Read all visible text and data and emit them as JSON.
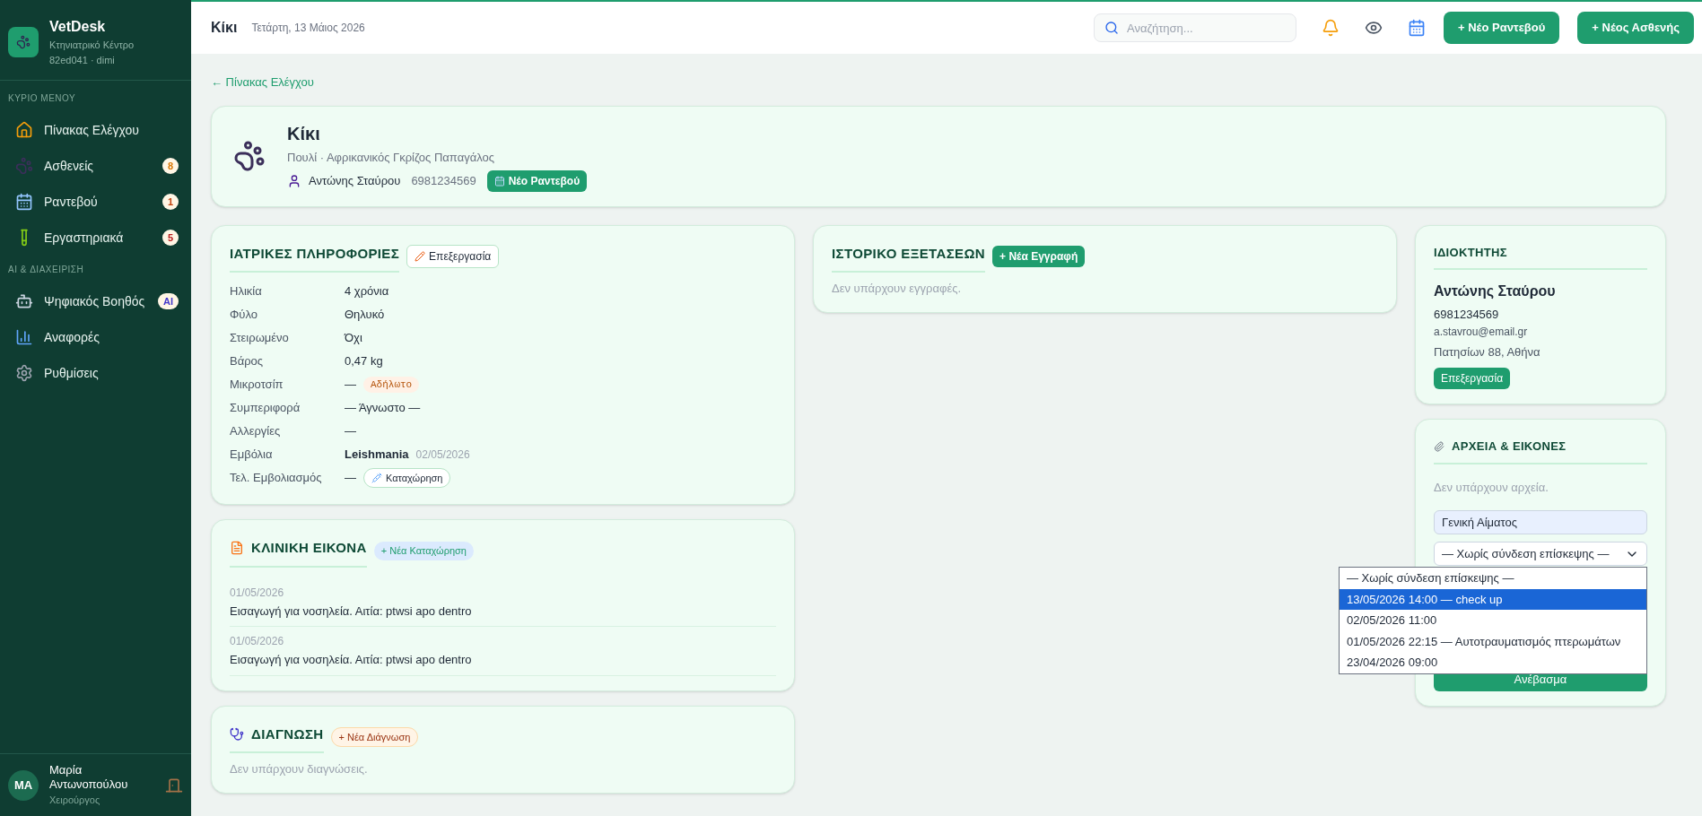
{
  "sidebar": {
    "app_name": "VetDesk",
    "subtitle": "Κτηνιατρικό Κέντρο",
    "build": "82ed041 · dimi",
    "sections": [
      {
        "title": "ΚΥΡΙΟ ΜΕΝΟΥ",
        "items": [
          {
            "label": "Πίνακας Ελέγχου"
          },
          {
            "label": "Ασθενείς",
            "badge": "8",
            "color": "#d97706"
          },
          {
            "label": "Ραντεβού",
            "badge": "1",
            "color": "#c2410c"
          },
          {
            "label": "Εργαστηριακά",
            "badge": "5",
            "color": "#b91c1c"
          }
        ]
      },
      {
        "title": "AI & ΔΙΑΧΕΙΡΙΣΗ",
        "items": [
          {
            "label": "Ψηφιακός Βοηθός",
            "badge": "AI",
            "color": "#4338ca"
          },
          {
            "label": "Αναφορές"
          },
          {
            "label": "Ρυθμίσεις"
          }
        ]
      }
    ],
    "user": {
      "initials": "MA",
      "name": "Μαρία Αντωνοπούλου",
      "role": "Χειρούργος"
    }
  },
  "header": {
    "title": "Κίκι",
    "date": "Τετάρτη, 13 Μάιος 2026",
    "search": {
      "placeholder": "Αναζήτηση..."
    },
    "buttons": [
      "+ Νέο Ραντεβού",
      "+ Νέος Ασθενής"
    ]
  },
  "back_link": "← Πίνακας Ελέγχου",
  "patient": {
    "name": "Κίκι",
    "species": "Πουλί · Αφρικανικός Γκρίζος Παπαγάλος",
    "owner": "Αντώνης Σταύρου",
    "phone": "6981234569",
    "button": "Νέο Ραντεβού"
  },
  "medical_info": {
    "title": "ΙΑΤΡΙΚΕΣ ΠΛΗΡΟΦΟΡΙΕΣ",
    "edit_button": "Επεξεργασία",
    "rows": [
      {
        "label": "Ηλικία",
        "value": "4 χρόνια"
      },
      {
        "label": "Φύλο",
        "value": "Θηλυκό"
      },
      {
        "label": "Στειρωμένο",
        "value": "Όχι"
      },
      {
        "label": "Βάρος",
        "value": "0,47 kg"
      },
      {
        "label": "Μικροτσίπ",
        "value": "—",
        "tag": "Αδήλωτο"
      },
      {
        "label": "Συμπεριφορά",
        "value": "— Άγνωστο —"
      },
      {
        "label": "Αλλεργίες",
        "value": "—"
      },
      {
        "label": "Εμβόλια",
        "value": "Leishmania",
        "note": "02/05/2026"
      },
      {
        "label": "Τελ. Εμβολιασμός",
        "value": "—",
        "action": "Καταχώρηση"
      }
    ]
  },
  "clinical_picture": {
    "title": "ΚΛΙΝΙΚΗ ΕΙΚΟΝΑ",
    "add_button": "+ Νέα Καταχώρηση",
    "entries": [
      {
        "date": "01/05/2026",
        "text": "Εισαγωγή για νοσηλεία. Αιτία: ptwsi apo dentro"
      },
      {
        "date": "01/05/2026",
        "text": "Εισαγωγή για νοσηλεία. Αιτία: ptwsi apo dentro"
      }
    ]
  },
  "diagnosis": {
    "title": "ΔΙΑΓΝΩΣΗ",
    "add_button": "+ Νέα Διάγνωση",
    "empty": "Δεν υπάρχουν διαγνώσεις."
  },
  "exam_history": {
    "title": "ΙΣΤΟΡΙΚΟ ΕΞΕΤΑΣΕΩΝ",
    "add_button": "+ Νέα Εγγραφή",
    "empty": "Δεν υπάρχουν εγγραφές."
  },
  "owner": {
    "title": "ΙΔΙΟΚΤΗΤΗΣ",
    "name": "Αντώνης Σταύρου",
    "phone": "6981234569",
    "email": "a.stavrou@email.gr",
    "address": "Πατησίων 88, Αθήνα",
    "edit_button": "Επεξεργασία"
  },
  "files": {
    "title": "ΑΡΧΕΙΑ & ΕΙΚΟΝΕΣ",
    "empty": "Δεν υπάρχουν αρχεία.",
    "name_field": "Γενική Αίματος",
    "visit_select": "— Χωρίς σύνδεση επίσκεψης —",
    "options": [
      {
        "label": "— Χωρίς σύνδεση επίσκεψης —",
        "selected": false
      },
      {
        "label": "13/05/2026 14:00 — check up",
        "selected": true
      },
      {
        "label": "02/05/2026 11:00",
        "selected": false
      },
      {
        "label": "01/05/2026 22:15 — Αυτοτραυματισμός πτερωμάτων",
        "selected": false
      },
      {
        "label": "23/04/2026 09:00",
        "selected": false
      }
    ],
    "upload_button": "Ανέβασμα"
  }
}
